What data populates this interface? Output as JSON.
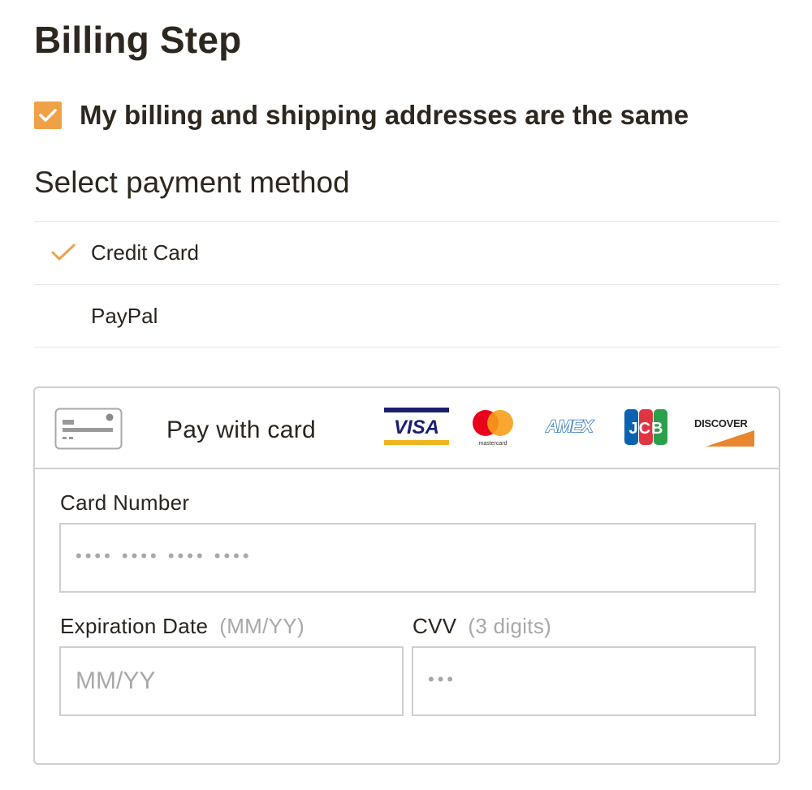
{
  "page": {
    "title": "Billing Step",
    "same_address": {
      "label": "My billing and shipping addresses are the same",
      "checked": true
    },
    "payment_section_title": "Select payment method"
  },
  "payment_methods": [
    {
      "label": "Credit Card",
      "selected": true
    },
    {
      "label": "PayPal",
      "selected": false
    }
  ],
  "card_form": {
    "header_label": "Pay with card",
    "header_icon": "credit-card-icon",
    "brands": [
      {
        "name": "visa-logo",
        "text": "VISA"
      },
      {
        "name": "mastercard-logo",
        "text": "mastercard"
      },
      {
        "name": "amex-logo",
        "text": "AMEX"
      },
      {
        "name": "jcb-logo",
        "text": "JCB"
      },
      {
        "name": "discover-logo",
        "text": "DISCOVER"
      }
    ],
    "card_number": {
      "label": "Card Number",
      "placeholder": "•••• •••• •••• ••••",
      "value": ""
    },
    "expiration": {
      "label": "Expiration Date",
      "hint": "(MM/YY)",
      "placeholder": "MM/YY",
      "value": ""
    },
    "cvv": {
      "label": "CVV",
      "hint": "(3 digits)",
      "placeholder": "•••",
      "value": ""
    }
  },
  "colors": {
    "accent": "#f0a148",
    "text": "#2e271f",
    "border": "#cfcfcf",
    "placeholder": "#a8a8a8",
    "visa_blue": "#1a1f71",
    "visa_gold": "#f0b41d",
    "mastercard_red": "#eb001b",
    "mastercard_orange": "#f79e1b",
    "amex_blue": "#2e77bc",
    "discover_orange": "#e9862f"
  }
}
